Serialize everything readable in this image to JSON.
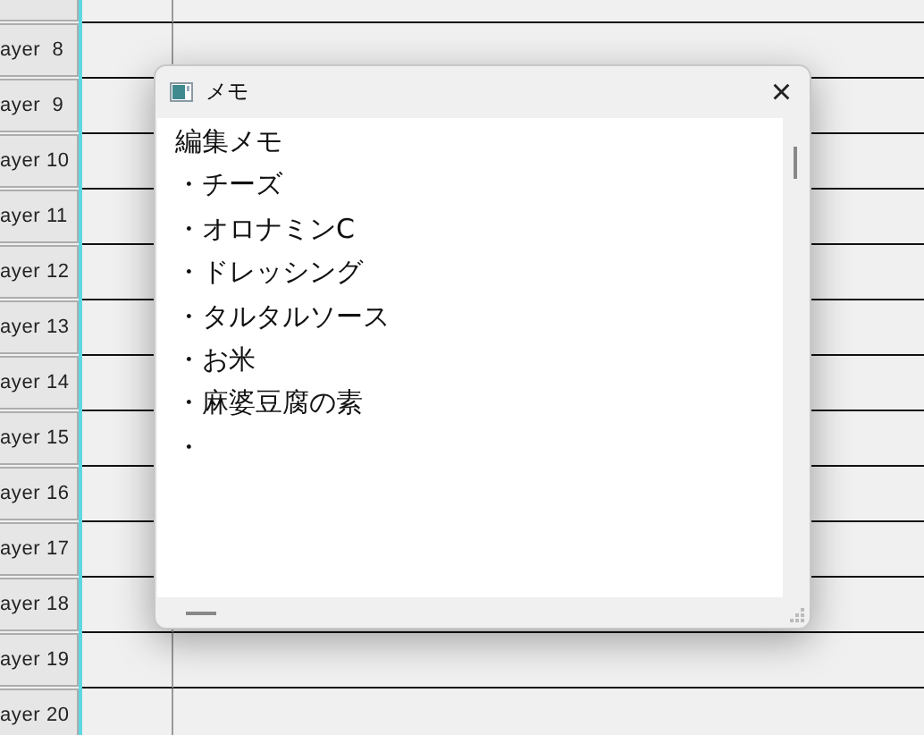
{
  "layers": [
    {
      "label": "ayer  8"
    },
    {
      "label": "ayer  9"
    },
    {
      "label": "ayer 10"
    },
    {
      "label": "ayer 11"
    },
    {
      "label": "ayer 12"
    },
    {
      "label": "ayer 13"
    },
    {
      "label": "ayer 14"
    },
    {
      "label": "ayer 15"
    },
    {
      "label": "ayer 16"
    },
    {
      "label": "ayer 17"
    },
    {
      "label": "ayer 18"
    },
    {
      "label": "ayer 19"
    },
    {
      "label": "ayer 20"
    }
  ],
  "memo_window": {
    "title": "メモ",
    "close": "×",
    "lines": [
      "編集メモ",
      "・チーズ",
      "・オロナミンC",
      "・ドレッシング",
      "・タルタルソース",
      "・お米",
      "・麻婆豆腐の素",
      "・"
    ]
  }
}
